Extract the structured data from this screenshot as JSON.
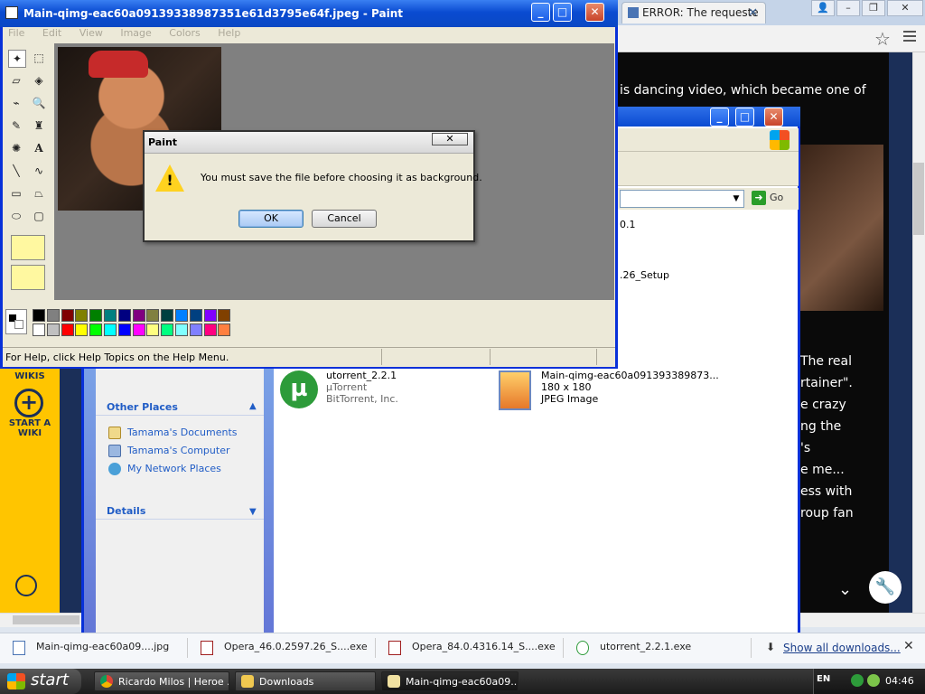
{
  "browser": {
    "tab_title": "ERROR: The requeste",
    "page_text_top": "is dancing video, which became one of",
    "page_text_right": [
      "The real",
      "rtainer\".",
      "e crazy",
      "ng the",
      "'s",
      "e me...",
      "ess with",
      "roup fan"
    ],
    "sidebar": {
      "label_wikis": "WIKIS",
      "label_start": "START A WIKI"
    }
  },
  "explorer": {
    "address_peek": "",
    "go_label": "Go",
    "peek_lines": [
      "0.1",
      ".26_Setup"
    ],
    "other_places_heading": "Other Places",
    "places": [
      "Tamama's Documents",
      "Tamama's Computer",
      "My Network Places"
    ],
    "details_heading": "Details",
    "files": [
      {
        "name": "utorrent_2.2.1",
        "line2": "µTorrent",
        "line3": "BitTorrent, Inc."
      },
      {
        "name": "Main-qimg-eac60a091393389873...",
        "line2": "180 x 180",
        "line3": "JPEG Image"
      }
    ]
  },
  "paint": {
    "title": "Main-qimg-eac60a09139338987351e61d3795e64f.jpeg - Paint",
    "menu": [
      "File",
      "Edit",
      "View",
      "Image",
      "Colors",
      "Help"
    ],
    "status": "For Help, click Help Topics on the Help Menu.",
    "palette_top": [
      "#000000",
      "#808080",
      "#800000",
      "#808000",
      "#008000",
      "#008080",
      "#000080",
      "#800080",
      "#808040",
      "#004040",
      "#0080ff",
      "#004080",
      "#8000ff",
      "#804000"
    ],
    "palette_bottom": [
      "#ffffff",
      "#c0c0c0",
      "#ff0000",
      "#ffff00",
      "#00ff00",
      "#00ffff",
      "#0000ff",
      "#ff00ff",
      "#ffff80",
      "#00ff80",
      "#80ffff",
      "#8080ff",
      "#ff0080",
      "#ff8040"
    ]
  },
  "dialog": {
    "title": "Paint",
    "message": "You must save the file before choosing it as background.",
    "ok_label": "OK",
    "cancel_label": "Cancel",
    "close_label": "✕"
  },
  "downloads": {
    "items": [
      "Main-qimg-eac60a09....jpg",
      "Opera_46.0.2597.26_S....exe",
      "Opera_84.0.4316.14_S....exe",
      "utorrent_2.2.1.exe"
    ],
    "show_all": "Show all downloads..."
  },
  "taskbar": {
    "start_label": "start",
    "tasks": [
      "Ricardo Milos | Heroe ...",
      "Downloads",
      "Main-qimg-eac60a09..."
    ],
    "language": "EN",
    "clock": "04:46"
  }
}
